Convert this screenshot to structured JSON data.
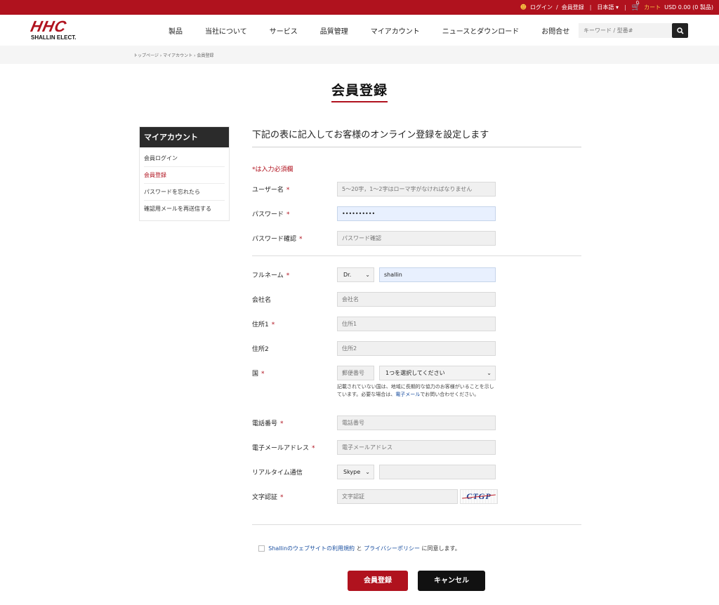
{
  "topbar": {
    "login": "ログイン",
    "register": "会員登録",
    "language": "日本語",
    "cart_count": "0",
    "cart": "カート",
    "cart_total": "USD 0.00 (0 製品)"
  },
  "header": {
    "logo_mark": "HHC",
    "logo_sub": "SHALLIN ELECT.",
    "nav": [
      "製品",
      "当社について",
      "サービス",
      "品質管理",
      "マイアカウント",
      "ニュースとダウンロード",
      "お問合せ"
    ],
    "search_placeholder": "キーワード / 型番#"
  },
  "breadcrumb": [
    "トップページ",
    "マイアカウント",
    "会員登録"
  ],
  "page_title": "会員登録",
  "sidebar": {
    "title": "マイアカウント",
    "items": [
      "会員ログイン",
      "会員登録",
      "パスワードを忘れたら",
      "確認用メールを再送信する"
    ]
  },
  "form": {
    "heading": "下記の表に記入してお客様のオンライン登録を設定します",
    "required_note": "*は入力必須欄",
    "required_mark": "*",
    "username": {
      "label": "ユーザー名",
      "placeholder": "5〜20字，1〜2字はローマ字がなければなりません"
    },
    "password": {
      "label": "パスワード",
      "value": "••••••••••"
    },
    "password_confirm": {
      "label": "パスワード確認",
      "placeholder": "パスワード確認"
    },
    "fullname": {
      "label": "フルネーム",
      "title_value": "Dr.",
      "name_value": "shallin"
    },
    "company": {
      "label": "会社名",
      "placeholder": "会社名"
    },
    "address1": {
      "label": "住所1",
      "placeholder": "住所1"
    },
    "address2": {
      "label": "住所2",
      "placeholder": "住所2"
    },
    "country": {
      "label": "国",
      "zip_placeholder": "郵便番号",
      "select_value": "1つを選択してください",
      "note_before": "記載されていない国は、地域に長期的な協力のお客様がいることを示しています。必要な場合は、",
      "note_link": "電子メール",
      "note_after": "でお問い合わせください。"
    },
    "phone": {
      "label": "電話番号",
      "placeholder": "電話番号"
    },
    "email": {
      "label": "電子メールアドレス",
      "placeholder": "電子メールアドレス"
    },
    "realtime": {
      "label": "リアルタイム通信",
      "select_value": "Skype"
    },
    "captcha": {
      "label": "文字認証",
      "placeholder": "文字認証",
      "code": "CTGP"
    }
  },
  "agreement": {
    "terms_link": "Shallinのウェブサイトの利用規約",
    "and": "と",
    "privacy_link": "プライバシーポリシー",
    "suffix": "に同意します。"
  },
  "buttons": {
    "register": "会員登録",
    "cancel": "キャンセル"
  },
  "colors": {
    "brand": "#b0121e",
    "dark": "#2b2b2b",
    "link": "#1a4fa0",
    "cart_label": "#f6c243"
  }
}
